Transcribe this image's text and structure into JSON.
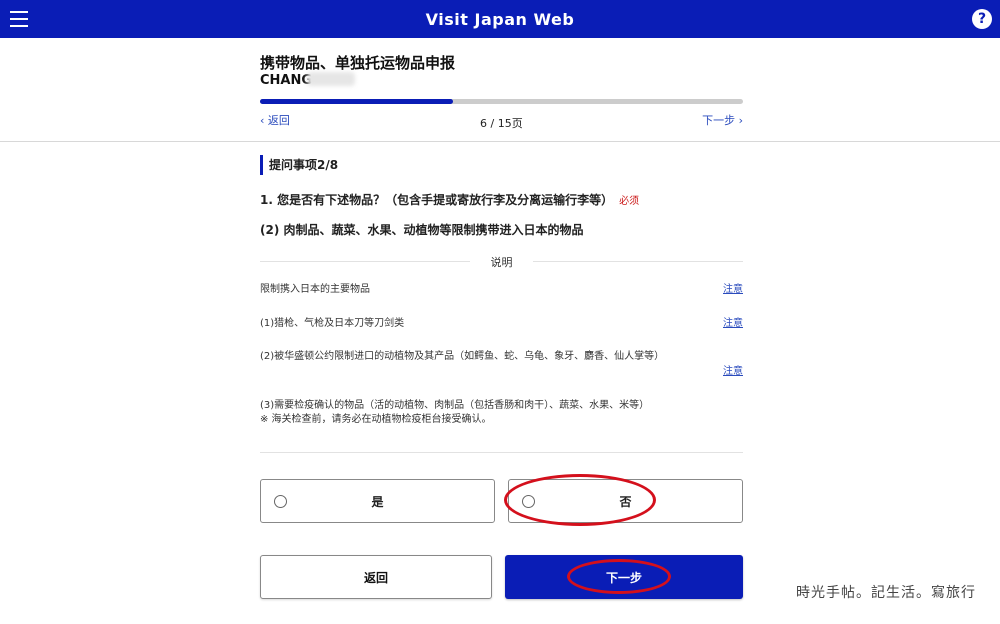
{
  "topbar": {
    "title": "Visit Japan Web",
    "menu_icon": "hamburger-icon",
    "help_icon": "?",
    "color": "#0a1db6"
  },
  "header": {
    "title": "携带物品、单独托运物品申报",
    "user_name": "CHANG",
    "progress": {
      "current": 6,
      "total": 15,
      "fraction": 0.4
    },
    "prev_label": "返回",
    "page_counter": "6 / 15页",
    "next_label": "下一步"
  },
  "section": {
    "heading": "提问事项2/8"
  },
  "question": {
    "text": "1. 您是否有下述物品？（包含手提或寄放行李及分离运输行李等）",
    "required_label": "必须",
    "sub_text": "(2) 肉制品、蔬菜、水果、动植物等限制携带进入日本的物品"
  },
  "explanation": {
    "label": "说明",
    "rows": [
      {
        "text": "限制携入日本的主要物品",
        "link": "注意"
      },
      {
        "text": "(1)猎枪、气枪及日本刀等刀剑类",
        "link": "注意"
      },
      {
        "text": "(2)被华盛顿公约限制进口的动植物及其产品（如鳄鱼、蛇、乌龟、象牙、麝香、仙人掌等）",
        "link": "注意"
      },
      {
        "text": "(3)需要检疫确认的物品（活的动植物、肉制品（包括香肠和肉干）、蔬菜、水果、米等）",
        "note": "※ 海关检查前，请务必在动植物检疫柜台接受确认。"
      }
    ]
  },
  "options": {
    "yes_label": "是",
    "no_label": "否"
  },
  "buttons": {
    "back_label": "返回",
    "next_label": "下一步"
  },
  "watermark": "時光手帖。記生活。寫旅行",
  "colors": {
    "brand": "#0a1db6",
    "annotation": "#d4101c",
    "required": "#cc1a1a"
  }
}
